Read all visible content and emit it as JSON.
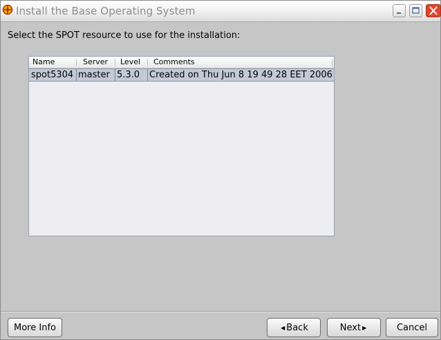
{
  "window": {
    "title": "Install the Base Operating System"
  },
  "prompt": "Select the SPOT resource to use for the installation:",
  "table": {
    "columns": [
      "Name",
      "Server",
      "Level",
      "Comments"
    ],
    "rows": [
      [
        "spot5304",
        "master",
        "5.3.0",
        "Created on Thu Jun 8 19 49 28 EET 2006"
      ]
    ]
  },
  "buttons": {
    "more_info": "More Info",
    "back": "Back",
    "next": "Next",
    "cancel": "Cancel"
  },
  "icons": {
    "app": "aix-wheel-icon",
    "minimize": "minimize-icon",
    "maximize": "maximize-icon",
    "close": "close-icon",
    "back_arrow": "left-arrow-icon",
    "next_arrow": "right-arrow-icon"
  },
  "colors": {
    "close_button": "#e0452b",
    "selected_row": "#c3cad7",
    "background": "#c6c6c6"
  }
}
